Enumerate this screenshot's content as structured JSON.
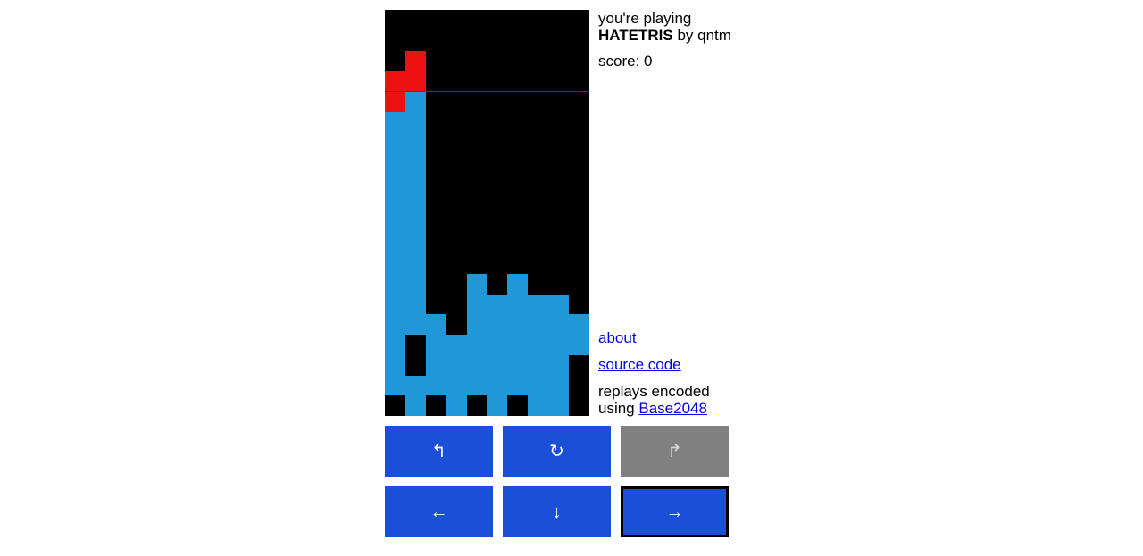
{
  "header": {
    "line1": "you're playing",
    "game_name": "HATETRIS",
    "byline": " by qntm",
    "score_label": "score: 0"
  },
  "links": {
    "about": "about",
    "source_code": "source code",
    "replays_prefix": "replays encoded using ",
    "base2048": "Base2048"
  },
  "controls": {
    "rotate_ccw": "↰",
    "rotate_cw": "↻",
    "redo": "↱",
    "left": "←",
    "down": "↓",
    "right": "→"
  },
  "colors": {
    "landed": "#2098d8",
    "live": "#ee1111",
    "well_bg": "#000000",
    "button": "#1c4fd8",
    "button_disabled": "#808080",
    "link": "#0000ee",
    "death_line": "#cc0000"
  },
  "board": {
    "columns": 10,
    "rows": 20,
    "legend": {
      "0": "empty",
      "1": "landed",
      "2": "live"
    },
    "grid": [
      [
        0,
        0,
        0,
        0,
        0,
        0,
        0,
        0,
        0,
        0
      ],
      [
        0,
        0,
        0,
        0,
        0,
        0,
        0,
        0,
        0,
        0
      ],
      [
        0,
        2,
        0,
        0,
        0,
        0,
        0,
        0,
        0,
        0
      ],
      [
        2,
        2,
        0,
        0,
        0,
        0,
        0,
        0,
        0,
        0
      ],
      [
        2,
        1,
        0,
        0,
        0,
        0,
        0,
        0,
        0,
        0
      ],
      [
        1,
        1,
        0,
        0,
        0,
        0,
        0,
        0,
        0,
        0
      ],
      [
        1,
        1,
        0,
        0,
        0,
        0,
        0,
        0,
        0,
        0
      ],
      [
        1,
        1,
        0,
        0,
        0,
        0,
        0,
        0,
        0,
        0
      ],
      [
        1,
        1,
        0,
        0,
        0,
        0,
        0,
        0,
        0,
        0
      ],
      [
        1,
        1,
        0,
        0,
        0,
        0,
        0,
        0,
        0,
        0
      ],
      [
        1,
        1,
        0,
        0,
        0,
        0,
        0,
        0,
        0,
        0
      ],
      [
        1,
        1,
        0,
        0,
        0,
        0,
        0,
        0,
        0,
        0
      ],
      [
        1,
        1,
        0,
        0,
        0,
        0,
        0,
        0,
        0,
        0
      ],
      [
        1,
        1,
        0,
        0,
        1,
        0,
        1,
        0,
        0,
        0
      ],
      [
        1,
        1,
        0,
        0,
        1,
        1,
        1,
        1,
        1,
        0
      ],
      [
        1,
        1,
        1,
        0,
        1,
        1,
        1,
        1,
        1,
        1
      ],
      [
        1,
        0,
        1,
        1,
        1,
        1,
        1,
        1,
        1,
        1
      ],
      [
        1,
        0,
        1,
        1,
        1,
        1,
        1,
        1,
        1,
        0
      ],
      [
        1,
        1,
        1,
        1,
        1,
        1,
        1,
        1,
        1,
        0
      ],
      [
        0,
        1,
        0,
        1,
        0,
        1,
        0,
        1,
        1,
        0
      ]
    ]
  }
}
